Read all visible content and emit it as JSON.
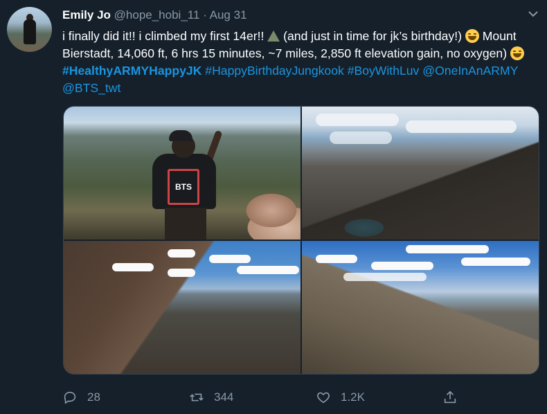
{
  "tweet": {
    "author_name": "Emily Jo",
    "handle": "@hope_hobi_11",
    "separator": "·",
    "date": "Aug 31",
    "text_parts": {
      "p1": "i finally did it!! i climbed my first 14er!! ",
      "p2": " (and just in time for jk’s birthday!) ",
      "p3": " Mount Bierstadt, 14,060 ft, 6 hrs 15 minutes, ~7 miles, 2,850 ft elevation gain, no oxygen) ",
      "p4": " "
    },
    "hashtags": {
      "h1": "#HealthyARMYHappyJK",
      "h2": "#HappyBirthdayJungkook",
      "h3": "#BoyWithLuv"
    },
    "mentions": {
      "m1": "@OneInAnARMY",
      "m2": "@BTS_twt"
    },
    "patch_text": "BTS"
  },
  "actions": {
    "replies": "28",
    "retweets": "344",
    "likes": "1.2K"
  },
  "icons": {
    "caret": "chevron-down-icon",
    "reply": "reply-icon",
    "retweet": "retweet-icon",
    "like": "heart-icon",
    "share": "share-icon"
  },
  "colors": {
    "background": "#15202b",
    "link": "#1b95e0",
    "muted": "#8899a6"
  }
}
